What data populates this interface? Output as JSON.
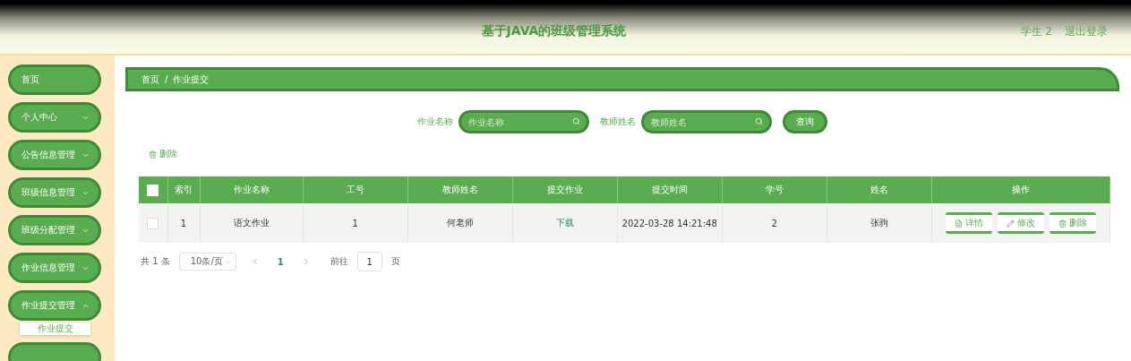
{
  "header": {
    "title": "基于JAVA的班级管理系统",
    "user": "学生 2",
    "logout": "退出登录"
  },
  "sidebar": {
    "items": [
      {
        "label": "首页",
        "expandable": false
      },
      {
        "label": "个人中心",
        "expandable": true,
        "expanded": false
      },
      {
        "label": "公告信息管理",
        "expandable": true,
        "expanded": false
      },
      {
        "label": "班级信息管理",
        "expandable": true,
        "expanded": false
      },
      {
        "label": "班级分配管理",
        "expandable": true,
        "expanded": false
      },
      {
        "label": "作业信息管理",
        "expandable": true,
        "expanded": false
      },
      {
        "label": "作业提交管理",
        "expandable": true,
        "expanded": true,
        "children": [
          {
            "label": "作业提交"
          }
        ]
      },
      {
        "expandable": false
      }
    ]
  },
  "breadcrumb": {
    "items": [
      "首页",
      "作业提交"
    ],
    "separator": "/"
  },
  "search": {
    "fields": [
      {
        "label": "作业名称",
        "placeholder": "作业名称"
      },
      {
        "label": "教师姓名",
        "placeholder": "教师姓名"
      }
    ],
    "button": "查询"
  },
  "delete_action": "删除",
  "table": {
    "header_checked": false,
    "columns": [
      "索引",
      "作业名称",
      "工号",
      "教师姓名",
      "提交作业",
      "提交时间",
      "学号",
      "姓名",
      "操作"
    ],
    "rows": [
      {
        "checked": false,
        "cells": [
          "1",
          "语文作业",
          "1",
          "何老师",
          "下载",
          "2022-03-28 14:21:48",
          "2",
          "张驹"
        ],
        "actions": [
          "详情",
          "修改",
          "删除"
        ]
      }
    ]
  },
  "pagination": {
    "total": "共 1 条",
    "page_size": "10条/页",
    "pages": [
      {
        "label": "1",
        "selected": true
      }
    ],
    "goto_label": "前往",
    "goto_value": "1",
    "goto_suffix": "页"
  }
}
